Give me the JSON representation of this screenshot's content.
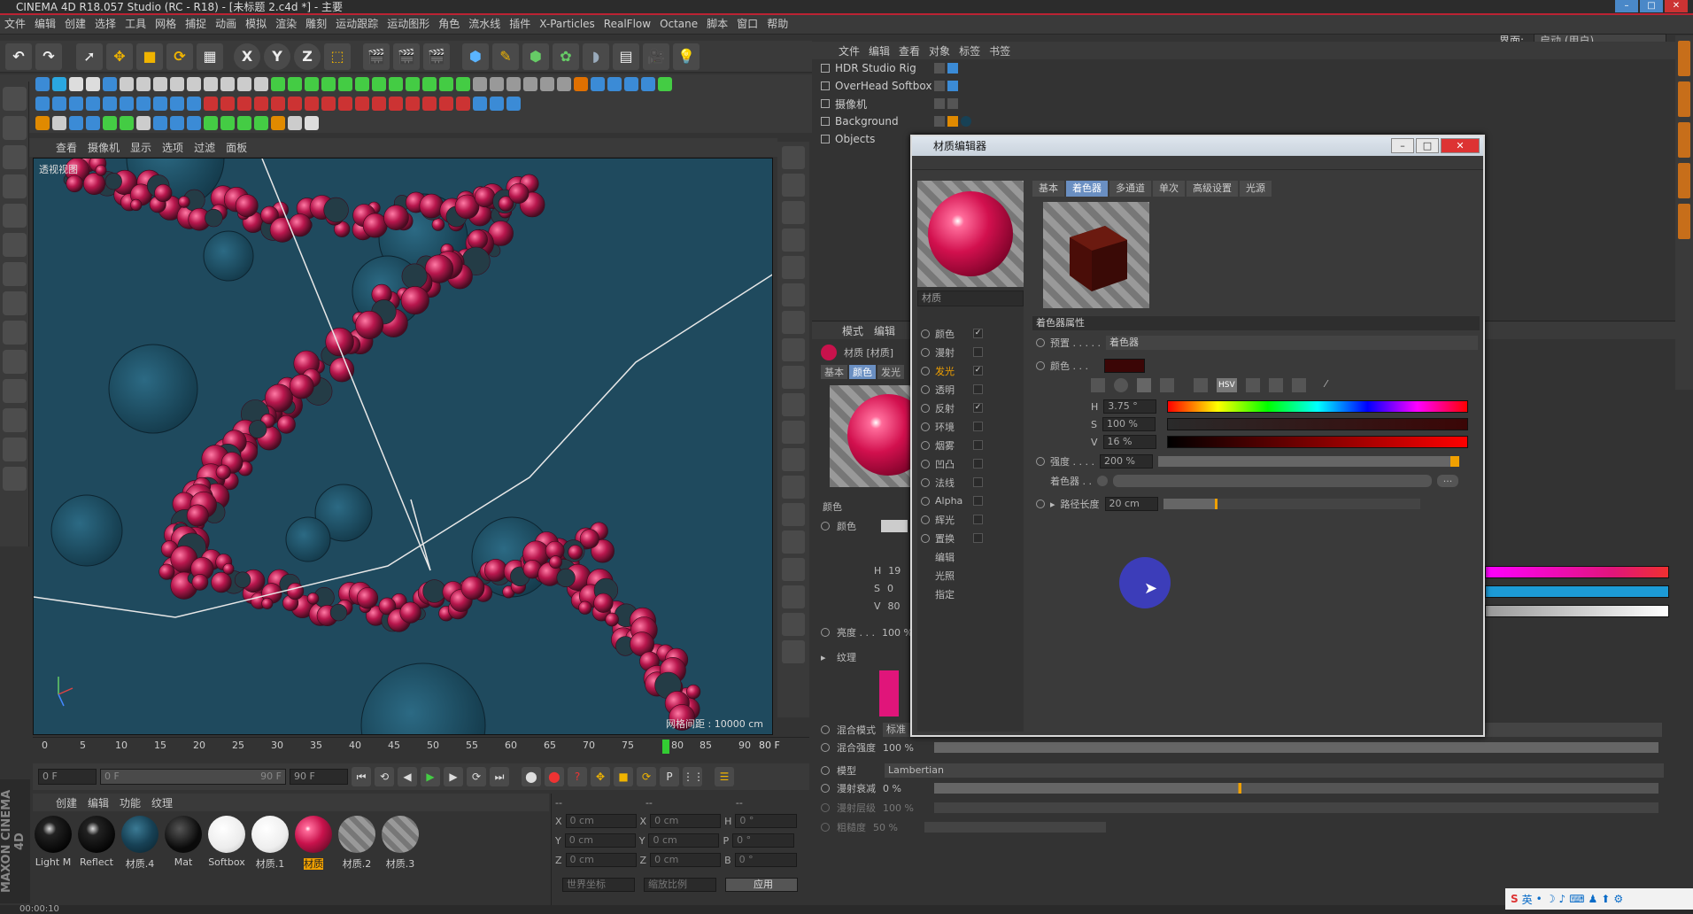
{
  "title": "CINEMA 4D R18.057 Studio (RC - R18) - [未标题 2.c4d *] - 主要",
  "menu": [
    "文件",
    "编辑",
    "创建",
    "选择",
    "工具",
    "网格",
    "捕捉",
    "动画",
    "模拟",
    "渲染",
    "雕刻",
    "运动跟踪",
    "运动图形",
    "角色",
    "流水线",
    "插件",
    "X-Particles",
    "RealFlow",
    "Octane",
    "脚本",
    "窗口",
    "帮助"
  ],
  "layout": {
    "label": "界面:",
    "value": "启动 (用户)"
  },
  "viewport": {
    "menu": [
      "查看",
      "摄像机",
      "显示",
      "选项",
      "过滤",
      "面板"
    ],
    "label": "透视视图",
    "grid": "网格间距 : 10000 cm",
    "bg": "#1f4a5e"
  },
  "timeline": {
    "ticks": [
      "0",
      "5",
      "10",
      "15",
      "20",
      "25",
      "30",
      "35",
      "40",
      "45",
      "50",
      "55",
      "60",
      "65",
      "70",
      "75",
      "80",
      "85",
      "90"
    ],
    "current": "80",
    "end_label": "80 F"
  },
  "transport": {
    "start": "0 F",
    "range_start": "0 F",
    "range_end": "90 F",
    "end": "90 F"
  },
  "material_manager": {
    "menu": [
      "创建",
      "编辑",
      "功能",
      "纹理"
    ],
    "materials": [
      {
        "name": "Light M",
        "color": "#111"
      },
      {
        "name": "Reflect",
        "color": "#151515"
      },
      {
        "name": "材质.4",
        "color": "#174155"
      },
      {
        "name": "Mat",
        "color": "#0a0a0a"
      },
      {
        "name": "Softbox",
        "color": "#f4f4f4"
      },
      {
        "name": "材质.1",
        "color": "#efefef"
      },
      {
        "name": "材质",
        "color": "#c8124c",
        "selected": true
      },
      {
        "name": "材质.2",
        "color": "#777"
      },
      {
        "name": "材质.3",
        "color": "#777"
      }
    ]
  },
  "coords": {
    "header": "--",
    "rows": [
      {
        "a": "X",
        "av": "0 cm",
        "b": "X",
        "bv": "0 cm",
        "c": "H",
        "cv": "0 °"
      },
      {
        "a": "Y",
        "av": "0 cm",
        "b": "Y",
        "bv": "0 cm",
        "c": "P",
        "cv": "0 °"
      },
      {
        "a": "Z",
        "av": "0 cm",
        "b": "Z",
        "bv": "0 cm",
        "c": "B",
        "cv": "0 °"
      }
    ],
    "world": "世界坐标",
    "scale": "缩放比例",
    "apply": "应用"
  },
  "status": "00:00:10",
  "object_manager": {
    "menu": [
      "文件",
      "编辑",
      "查看",
      "对象",
      "标签",
      "书签"
    ],
    "objects": [
      "HDR Studio Rig",
      "OverHead Softbox",
      "摄像机",
      "Background",
      "Objects"
    ]
  },
  "attr_manager": {
    "menu": [
      "模式",
      "编辑"
    ],
    "title": "材质 [材质]",
    "tabs": [
      "基本",
      "颜色",
      "发光"
    ],
    "color_section": "颜色",
    "color_label": "颜色",
    "h": "H",
    "h_val": "19",
    "s": "S",
    "s_val": "0",
    "v": "V",
    "v_val": "80",
    "brightness": "亮度 . . .",
    "brightness_val": "100 %",
    "texture": "纹理",
    "blend_mode": "混合模式",
    "blend_mode_val": "标准",
    "blend_strength": "混合强度",
    "blend_strength_val": "100 %",
    "model": "模型",
    "model_val": "Lambertian",
    "diffuse_falloff": "漫射衰减",
    "diffuse_falloff_val": "0 %",
    "diffuse_level": "漫射层级",
    "diffuse_level_val": "100 %",
    "roughness": "粗糙度",
    "roughness_val": "50 %"
  },
  "dialog": {
    "title": "材质编辑器",
    "mat_name": "材质",
    "channels": [
      {
        "name": "颜色",
        "checked": true
      },
      {
        "name": "漫射",
        "checked": false
      },
      {
        "name": "发光",
        "checked": true,
        "active": true
      },
      {
        "name": "透明",
        "checked": false
      },
      {
        "name": "反射",
        "checked": true
      },
      {
        "name": "环境",
        "checked": false
      },
      {
        "name": "烟雾",
        "checked": false
      },
      {
        "name": "凹凸",
        "checked": false
      },
      {
        "name": "法线",
        "checked": false
      },
      {
        "name": "Alpha",
        "checked": false
      },
      {
        "name": "辉光",
        "checked": false
      },
      {
        "name": "置换",
        "checked": false
      }
    ],
    "extras": [
      "编辑",
      "光照",
      "指定"
    ],
    "tabs": [
      "基本",
      "着色器",
      "多通道",
      "单次",
      "高级设置",
      "光源"
    ],
    "active_tab": "着色器",
    "section": "着色器属性",
    "preset_label": "预置 . . . . .",
    "preset_val": "着色器",
    "color_label": "颜色 . . .",
    "h_label": "H",
    "h_val": "3.75 °",
    "s_label": "S",
    "s_val": "100 %",
    "v_label": "V",
    "v_val": "16 %",
    "strength_label": "强度 . . . .",
    "strength_val": "200 %",
    "shader_label": "着色器 . .",
    "path_label": "路径长度",
    "path_val": "20 cm",
    "hsv_btn": "HSV",
    "swatch": "#3b0606"
  }
}
